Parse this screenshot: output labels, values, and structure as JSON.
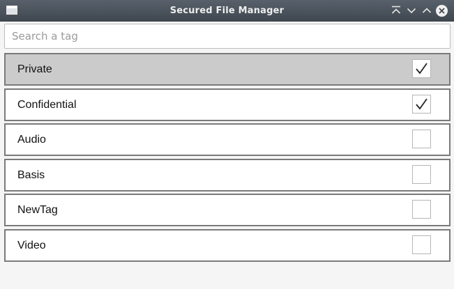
{
  "window": {
    "title": "Secured File Manager"
  },
  "search": {
    "placeholder": "Search a tag",
    "value": ""
  },
  "tags": [
    {
      "label": "Private",
      "checked": true,
      "selected": true
    },
    {
      "label": "Confidential",
      "checked": true,
      "selected": false
    },
    {
      "label": "Audio",
      "checked": false,
      "selected": false
    },
    {
      "label": "Basis",
      "checked": false,
      "selected": false
    },
    {
      "label": "NewTag",
      "checked": false,
      "selected": false
    },
    {
      "label": "Video",
      "checked": false,
      "selected": false
    }
  ],
  "icons": {
    "app": "window-icon",
    "shade": "shade-icon",
    "minimize": "minimize-icon",
    "maximize": "maximize-icon",
    "close": "close-icon",
    "check": "check-icon"
  },
  "colors": {
    "titlebar": "#4b535c",
    "selected_row": "#cbcbcb",
    "row_border": "#7a7a7a"
  }
}
